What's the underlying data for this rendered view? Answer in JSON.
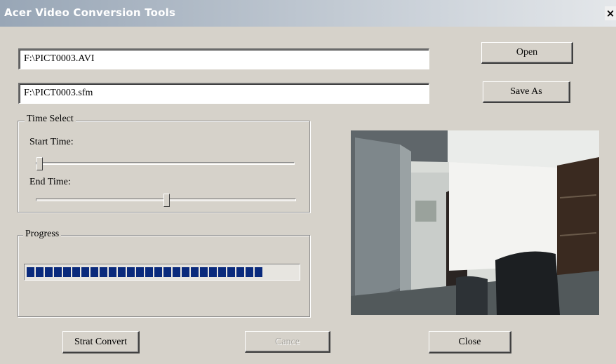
{
  "window": {
    "title": "Acer Video Conversion Tools"
  },
  "titlebar": {
    "close_glyph": "×"
  },
  "files": {
    "input_value": "F:\\PICT0003.AVI",
    "output_value": "F:\\PICT0003.sfm",
    "open_label": "Open",
    "save_as_label": "Save As"
  },
  "time_select": {
    "legend": "Time Select",
    "start_label": "Start Time:",
    "end_label": "End Time:",
    "start_position": 0.0,
    "end_position": 0.5
  },
  "progress": {
    "legend": "Progress",
    "fraction": 0.88
  },
  "actions": {
    "convert_label": "Strat Convert",
    "cancel_label": "Cance",
    "close_label": "Close"
  },
  "preview": {
    "icon": "video-frame"
  }
}
